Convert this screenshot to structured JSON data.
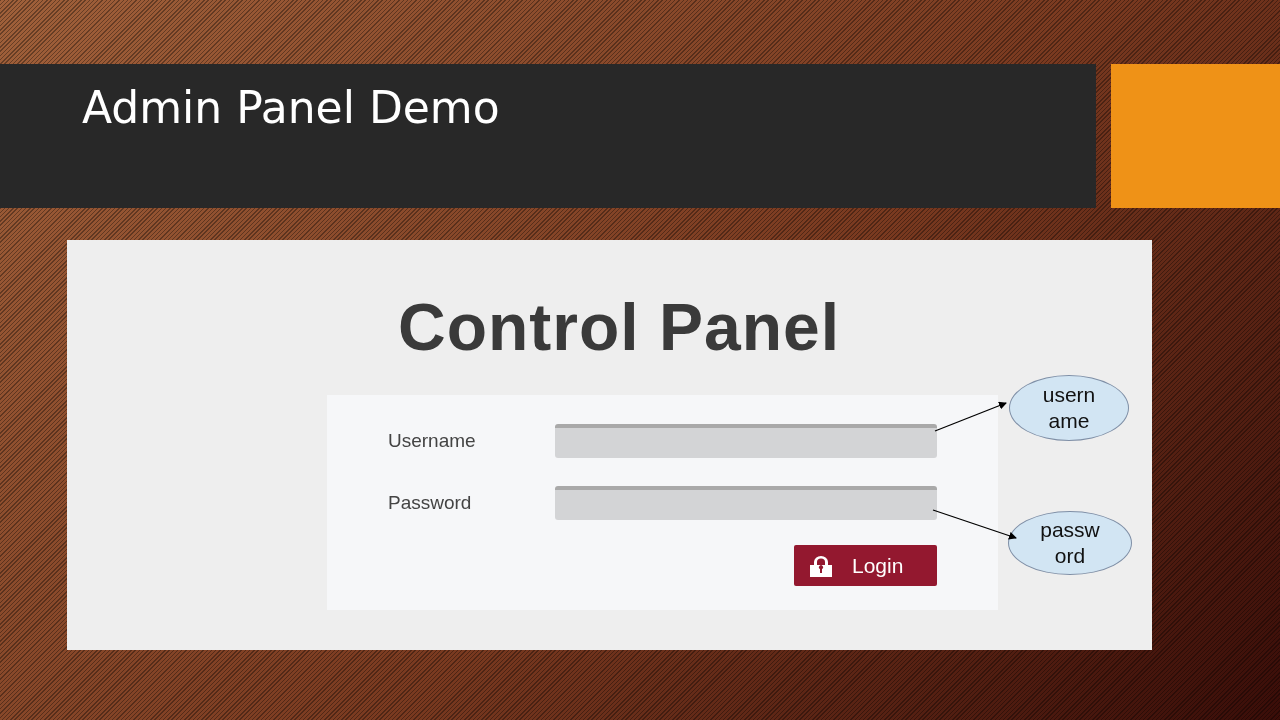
{
  "slide": {
    "title": "Admin Panel Demo"
  },
  "screenshot": {
    "heading": "Control Panel",
    "fields": [
      {
        "label": "Username"
      },
      {
        "label": "Password"
      }
    ],
    "button": "Login"
  },
  "callouts": [
    {
      "text": "usern\name"
    },
    {
      "text": "passw\nord"
    }
  ]
}
